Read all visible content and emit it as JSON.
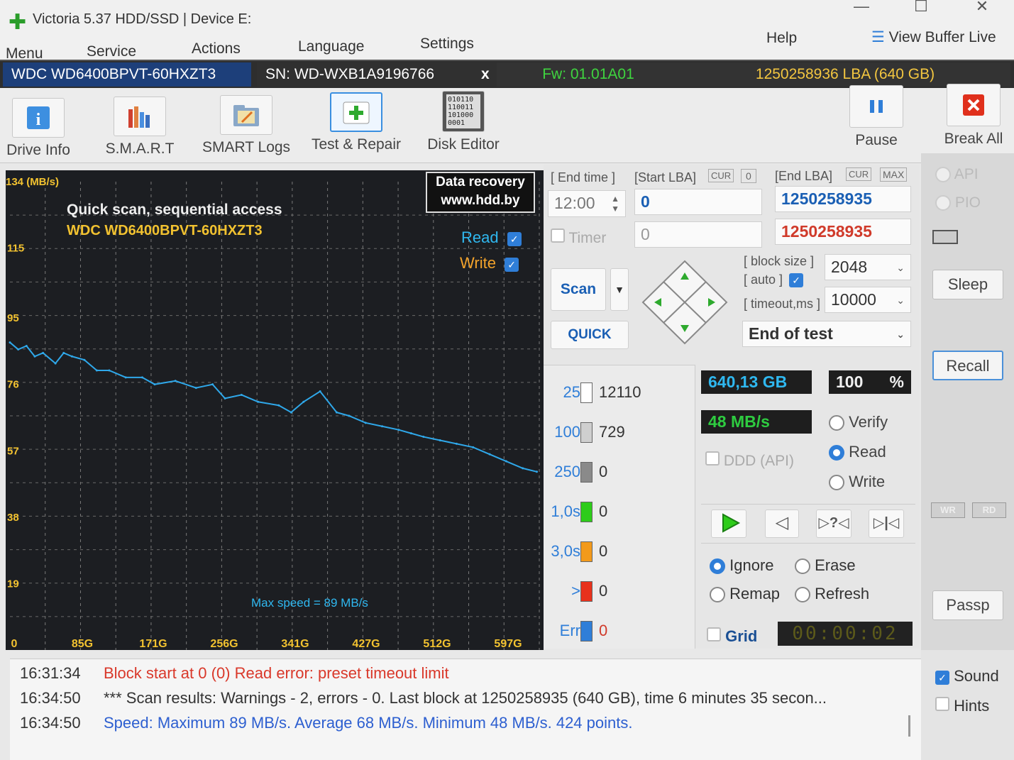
{
  "window": {
    "title": "Victoria 5.37 HDD/SSD | Device E:",
    "controls": [
      "—",
      "☐",
      "✕"
    ]
  },
  "menu": {
    "items": [
      "Menu",
      "Service",
      "Actions",
      "Language",
      "Settings"
    ],
    "help": "Help",
    "view_buffer": "View Buffer Live"
  },
  "drive": {
    "model": "WDC WD6400BPVT-60HXZT3",
    "serial": "SN: WD-WXB1A9196766",
    "close": "x",
    "firmware": "Fw: 01.01A01",
    "capacity": "1250258936 LBA (640 GB)"
  },
  "toolbar": {
    "drive_info": "Drive Info",
    "smart": "S.M.A.R.T",
    "smart_logs": "SMART Logs",
    "test_repair": "Test & Repair",
    "disk_editor": "Disk Editor",
    "disk_editor_bits": [
      "010110",
      "110011",
      "101000",
      "0001"
    ],
    "pause": "Pause",
    "break_all": "Break All"
  },
  "chart_data": {
    "type": "line",
    "title": "Quick scan, sequential access",
    "subtitle": "WDC WD6400BPVT-60HXZT3",
    "ylabel": "134 (MB/s)",
    "y_ticks": [
      115,
      95,
      76,
      57,
      38,
      19
    ],
    "ylim": [
      0,
      134
    ],
    "x_ticks": [
      "0",
      "85G",
      "171G",
      "256G",
      "341G",
      "427G",
      "512G",
      "597G"
    ],
    "xlim": [
      0,
      640
    ],
    "watermark": [
      "Data recovery",
      "www.hdd.by"
    ],
    "legend": {
      "read": "Read",
      "write": "Write"
    },
    "annotation": "Max speed = 89 MB/s",
    "grid": true,
    "series": [
      {
        "name": "Read",
        "x": [
          0,
          10,
          20,
          30,
          40,
          55,
          65,
          75,
          90,
          105,
          120,
          140,
          160,
          175,
          200,
          225,
          245,
          260,
          280,
          300,
          325,
          340,
          355,
          375,
          395,
          410,
          430,
          450,
          470,
          485,
          500,
          520,
          540,
          560,
          580,
          600,
          620,
          637
        ],
        "y": [
          88,
          86,
          87,
          84,
          85,
          82,
          85,
          84,
          83,
          80,
          80,
          78,
          78,
          76,
          77,
          75,
          76,
          72,
          73,
          71,
          70,
          68,
          71,
          74,
          68,
          67,
          65,
          64,
          63,
          62,
          61,
          60,
          59,
          58,
          56,
          54,
          52,
          51
        ]
      }
    ]
  },
  "control": {
    "end_time_label": "[ End time ]",
    "end_time": "12:00",
    "timer_label": "Timer",
    "timer_value": "0",
    "start_lba_label": "[Start LBA]",
    "cur": "CUR",
    "cur_zero": "0",
    "start_lba": "0",
    "end_lba_label": "[End LBA]",
    "max": "MAX",
    "end_lba": "1250258935",
    "end_lba2": "1250258935",
    "scan": "Scan",
    "quick": "QUICK",
    "block_size_label": "[ block size ]",
    "auto_label": "[ auto ]",
    "block_size": "2048",
    "timeout_label": "[ timeout,ms ]",
    "timeout": "10000",
    "end_of_test": "End of test"
  },
  "stats": [
    {
      "label": "25",
      "value": "12110",
      "color": "#ffffff",
      "fill": 0.9
    },
    {
      "label": "100",
      "value": "729",
      "color": "#cfcfcf",
      "fill": 0.9
    },
    {
      "label": "250",
      "value": "0",
      "color": "#8a8a8a",
      "fill": 0.9
    },
    {
      "label": "1,0s",
      "value": "0",
      "color": "#2ecc1a",
      "fill": 0.9
    },
    {
      "label": "3,0s",
      "value": "0",
      "color": "#f39a1b",
      "fill": 0.9
    },
    {
      "label": ">",
      "value": "0",
      "color": "#e8321c",
      "fill": 0.9
    },
    {
      "label": "Err",
      "value": "0",
      "color": "#2f7ed8",
      "fill": 0.9
    }
  ],
  "readouts": {
    "gb": "640,13 GB",
    "percent": "100",
    "percent_sign": "%",
    "speed": "48 MB/s",
    "ddd": "DDD (API)",
    "timer_display": "00:00:02"
  },
  "mode": {
    "verify": "Verify",
    "read": "Read",
    "write": "Write"
  },
  "action": {
    "ignore": "Ignore",
    "erase": "Erase",
    "remap": "Remap",
    "refresh": "Refresh",
    "grid": "Grid"
  },
  "playback": {
    "back": "◁",
    "skip_q": "▷?◁",
    "end": "▷|◁"
  },
  "sidebar": {
    "api": "API",
    "pio": "PIO",
    "sleep": "Sleep",
    "recall": "Recall",
    "wr": "WR",
    "rd": "RD",
    "passp": "Passp",
    "sound": "Sound",
    "hints": "Hints"
  },
  "log": [
    {
      "time": "16:31:34",
      "text": "Block start at 0 (0) Read error: preset timeout limit",
      "color": "#d9382a"
    },
    {
      "time": "16:34:50",
      "text": "*** Scan results: Warnings - 2, errors - 0. Last block at 1250258935 (640 GB), time 6 minutes 35 secon...",
      "color": "#333333"
    },
    {
      "time": "16:34:50",
      "text": "Speed: Maximum 89 MB/s. Average 68 MB/s. Minimum 48 MB/s. 424 points.",
      "color": "#2d5fd0"
    }
  ]
}
